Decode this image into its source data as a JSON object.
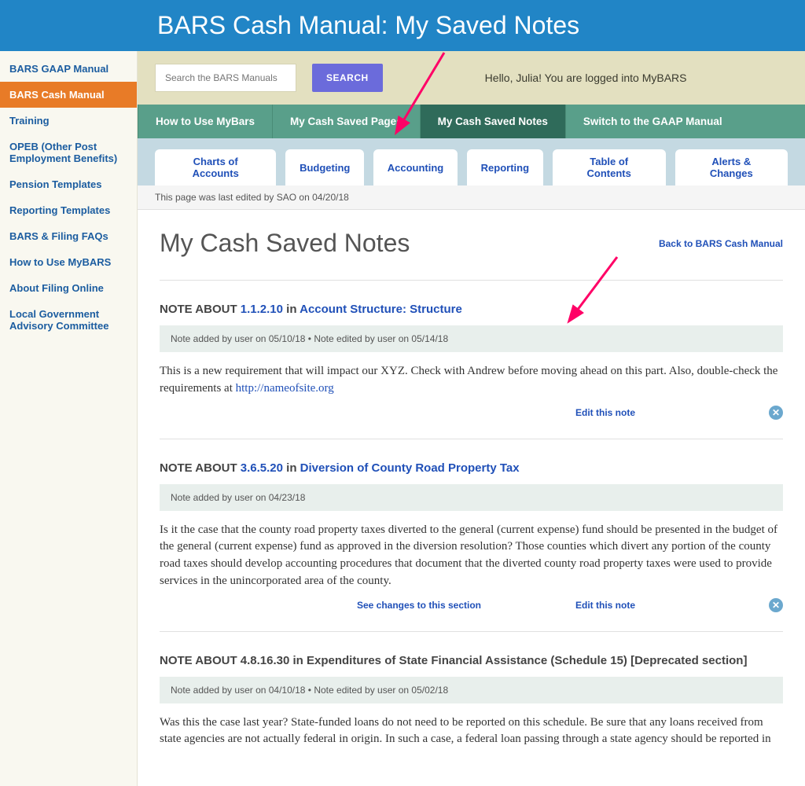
{
  "header": {
    "title": "BARS Cash Manual: My Saved Notes"
  },
  "sidebar": {
    "items": [
      {
        "label": "BARS GAAP Manual",
        "active": false
      },
      {
        "label": "BARS Cash Manual",
        "active": true
      },
      {
        "label": "Training",
        "active": false
      },
      {
        "label": "OPEB (Other Post Employment Benefits)",
        "active": false
      },
      {
        "label": "Pension Templates",
        "active": false
      },
      {
        "label": "Reporting Templates",
        "active": false
      },
      {
        "label": "BARS & Filing FAQs",
        "active": false
      },
      {
        "label": "How to Use MyBARS",
        "active": false
      },
      {
        "label": "About Filing Online",
        "active": false
      },
      {
        "label": "Local Government Advisory Committee",
        "active": false
      }
    ]
  },
  "search": {
    "placeholder": "Search the BARS Manuals",
    "button": "SEARCH"
  },
  "greeting": "Hello, Julia! You are logged into MyBARS",
  "nav_tabs": [
    {
      "label": "How to Use MyBars",
      "active": false
    },
    {
      "label": "My Cash Saved Pages",
      "active": false
    },
    {
      "label": "My Cash Saved Notes",
      "active": true
    },
    {
      "label": "Switch to the GAAP Manual",
      "active": false
    }
  ],
  "sub_tabs": [
    "Charts of Accounts",
    "Budgeting",
    "Accounting",
    "Reporting",
    "Table of Contents",
    "Alerts & Changes"
  ],
  "last_edited": "This page was last edited by SAO on 04/20/18",
  "page_title": "My Cash Saved Notes",
  "back_link": "Back to BARS Cash Manual",
  "notes": [
    {
      "prefix": "NOTE ABOUT ",
      "ref": "1.1.2.10",
      "mid": " in ",
      "section": "Account Structure: Structure",
      "meta": "Note added by user on 05/10/18  •  Note edited by user on 05/14/18",
      "body_pre": "This is a new requirement that will impact our XYZ. Check with Andrew before moving ahead on this part. Also, double-check the requirements at ",
      "body_link": "http://nameofsite.org",
      "body_post": "",
      "see_changes": "",
      "edit": "Edit this note"
    },
    {
      "prefix": "NOTE ABOUT ",
      "ref": "3.6.5.20",
      "mid": " in ",
      "section": "Diversion of County Road Property Tax",
      "meta": "Note added by user on 04/23/18",
      "body_pre": "Is it the case that the county road property taxes diverted to the general (current expense) fund should be presented in the budget of the general (current expense) fund as approved in the diversion resolution? Those counties which divert any portion of the county road taxes should develop accounting procedures that document that the diverted county road property taxes were used to provide services in the unincorporated area of the county.",
      "body_link": "",
      "body_post": "",
      "see_changes": "See changes to this section",
      "edit": "Edit this note"
    },
    {
      "prefix": "NOTE ABOUT  ",
      "ref": "",
      "mid": "",
      "section": "4.8.16.30 in Expenditures of State Financial Assistance (Schedule 15)  [Deprecated section]",
      "meta": "Note added by user on 04/10/18  •  Note edited by user on 05/02/18",
      "body_pre": "Was this the case last year? State-funded loans do not need to be reported on this schedule. Be sure that any loans received from state agencies are not actually federal in origin. In such a case, a federal loan passing through a state agency should be reported in",
      "body_link": "",
      "body_post": "",
      "see_changes": "",
      "edit": ""
    }
  ]
}
